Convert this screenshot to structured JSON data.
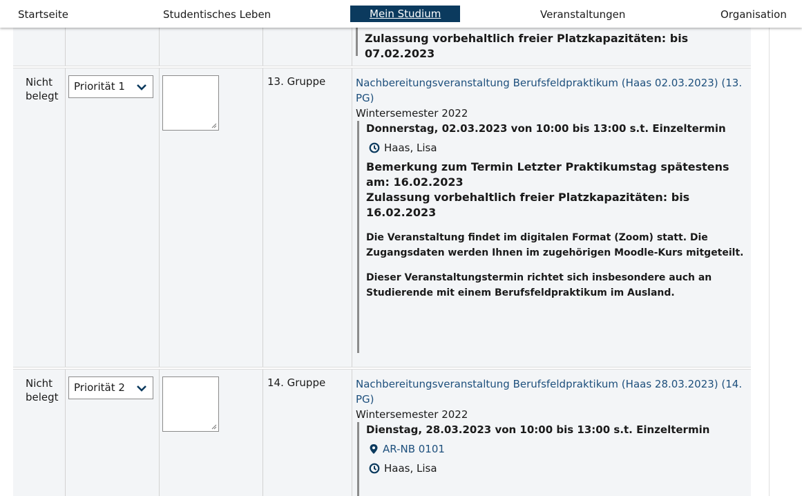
{
  "nav": {
    "items": [
      "Startseite",
      "Studentisches Leben",
      "Mein Studium",
      "Veranstaltungen",
      "Organisation"
    ],
    "active": "Mein Studium"
  },
  "row0": {
    "admission": "Zulassung vorbehaltlich freier Platzkapazitäten: bis 07.02.2023"
  },
  "row1": {
    "status": "Nicht belegt",
    "priority": "Priorität 1",
    "group": "13. Gruppe",
    "title": "Nachbereitungsveranstaltung Berufsfeldpraktikum (Haas 02.03.2023) (13. PG)",
    "semester": "Wintersemester 2022",
    "date": "Donnerstag, 02.03.2023 von 10:00 bis 13:00 s.t. Einzeltermin",
    "lecturer": "Haas, Lisa",
    "remark": "Bemerkung zum Termin Letzter Praktikumstag spätestens am: 16.02.2023",
    "admission": "Zulassung vorbehaltlich freier Platzkapazitäten: bis 16.02.2023",
    "note1": "Die Veranstaltung findet im digitalen Format (Zoom) statt. Die Zugangsdaten werden Ihnen im zugehörigen Moodle-Kurs mitgeteilt.",
    "note2": "Dieser Veranstaltungstermin richtet sich insbesondere auch an Studierende mit einem Berufsfeldpraktikum im Ausland."
  },
  "row2": {
    "status": "Nicht belegt",
    "priority": "Priorität 2",
    "group": "14. Gruppe",
    "title": "Nachbereitungsveranstaltung Berufsfeldpraktikum (Haas 28.03.2023) (14. PG)",
    "semester": "Wintersemester 2022",
    "date": "Dienstag, 28.03.2023 von 10:00 bis 13:00 s.t. Einzeltermin",
    "room": "AR-NB 0101",
    "lecturer": "Haas, Lisa"
  },
  "colors": {
    "nav_active_bg": "#0b3a5e",
    "link": "#1d4f7c",
    "row_bg": "#f3f5f7"
  },
  "icons": [
    "chevron-down-icon",
    "clock-icon",
    "map-pin-icon",
    "resize-grip-icon"
  ]
}
